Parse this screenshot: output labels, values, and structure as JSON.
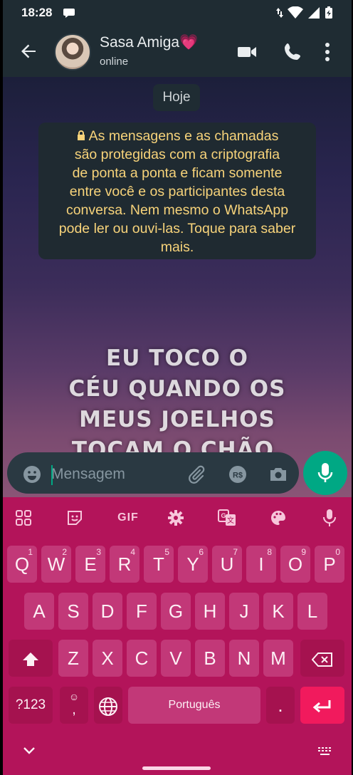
{
  "status_bar": {
    "time": "18:28"
  },
  "header": {
    "contact_name": "Sasa Amiga💗",
    "contact_status": "online"
  },
  "chat": {
    "date_chip": "Hoje",
    "encryption_notice": "As mensagens e as chamadas são protegidas com a criptografia de ponta a ponta e ficam somente entre você e os participantes desta conversa. Nem mesmo o WhatsApp pode ler ou ouvi-las. Toque para saber mais.",
    "encryption_lines": [
      "As mensagens e as chamadas",
      "são protegidas com a criptografia",
      "de ponta a ponta e ficam somente",
      "entre você e os participantes desta",
      "conversa. Nem mesmo o WhatsApp",
      "pode ler ou ouvi-las. Toque para saber",
      "mais."
    ],
    "wallpaper_lines": [
      "EU TOCO O",
      "CÉU QUANDO OS",
      "MEUS JOELHOS",
      "TOCAM O CHÃO."
    ]
  },
  "composer": {
    "placeholder": "Mensagem",
    "value": ""
  },
  "keyboard": {
    "toolbar": {
      "gif_label": "GIF"
    },
    "row1": [
      {
        "k": "Q",
        "h": "1"
      },
      {
        "k": "W",
        "h": "2"
      },
      {
        "k": "E",
        "h": "3"
      },
      {
        "k": "R",
        "h": "4"
      },
      {
        "k": "T",
        "h": "5"
      },
      {
        "k": "Y",
        "h": "6"
      },
      {
        "k": "U",
        "h": "7"
      },
      {
        "k": "I",
        "h": "8"
      },
      {
        "k": "O",
        "h": "9"
      },
      {
        "k": "P",
        "h": "0"
      }
    ],
    "row2": [
      "A",
      "S",
      "D",
      "F",
      "G",
      "H",
      "J",
      "K",
      "L"
    ],
    "row3": [
      "Z",
      "X",
      "C",
      "V",
      "B",
      "N",
      "M"
    ],
    "symbols_label": "?123",
    "comma_label": ",",
    "space_label": "Português",
    "period_label": "."
  },
  "colors": {
    "accent": "#00a884",
    "keyboard_bg": "#b3145a",
    "key_bg": "#c23878",
    "enter_key": "#f11a5d",
    "notice_text": "#f7d37a"
  }
}
